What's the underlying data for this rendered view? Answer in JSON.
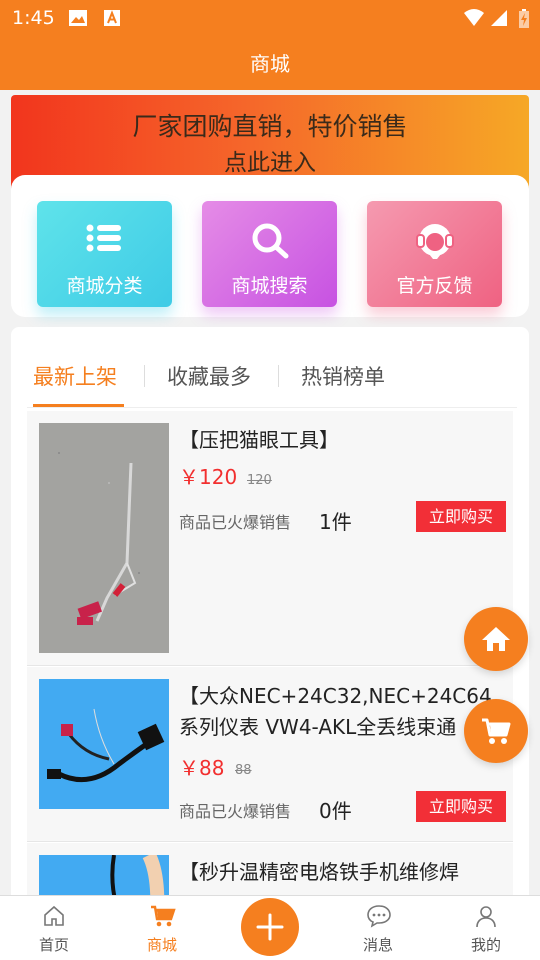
{
  "status_bar": {
    "time": "1:45"
  },
  "header": {
    "title": "商城"
  },
  "banner": {
    "line1": "厂家团购直销，特价销售",
    "line2": "点此进入"
  },
  "quick_actions": [
    {
      "label": "商城分类",
      "icon": "list-icon"
    },
    {
      "label": "商城搜索",
      "icon": "search-icon"
    },
    {
      "label": "官方反馈",
      "icon": "headset-icon"
    }
  ],
  "tabs": [
    {
      "label": "最新上架",
      "active": true
    },
    {
      "label": "收藏最多",
      "active": false
    },
    {
      "label": "热销榜单",
      "active": false
    }
  ],
  "products": [
    {
      "title": "【压把猫眼工具】",
      "price": "￥120",
      "old_price": "120",
      "sold_label": "商品已火爆销售",
      "sold_count": "1件",
      "buy_label": "立即购买"
    },
    {
      "title": "【大众NEC+24C32,NEC+24C64系列仪表 VW4-AKL全丢线束通",
      "price": "￥88",
      "old_price": "88",
      "sold_label": "商品已火爆销售",
      "sold_count": "0件",
      "buy_label": "立即购买"
    },
    {
      "title": "【秒升温精密电烙铁手机维修焊",
      "price": "",
      "old_price": "",
      "sold_label": "",
      "sold_count": "",
      "buy_label": ""
    }
  ],
  "bottom_nav": [
    {
      "label": "首页",
      "icon": "home-icon",
      "active": false
    },
    {
      "label": "商城",
      "icon": "cart-icon",
      "active": true
    },
    {
      "label": "",
      "icon": "plus-icon",
      "active": false
    },
    {
      "label": "消息",
      "icon": "message-icon",
      "active": false
    },
    {
      "label": "我的",
      "icon": "user-icon",
      "active": false
    }
  ],
  "colors": {
    "accent": "#f57f1f",
    "buy_button": "#f22f37",
    "price": "#f22f2f"
  }
}
